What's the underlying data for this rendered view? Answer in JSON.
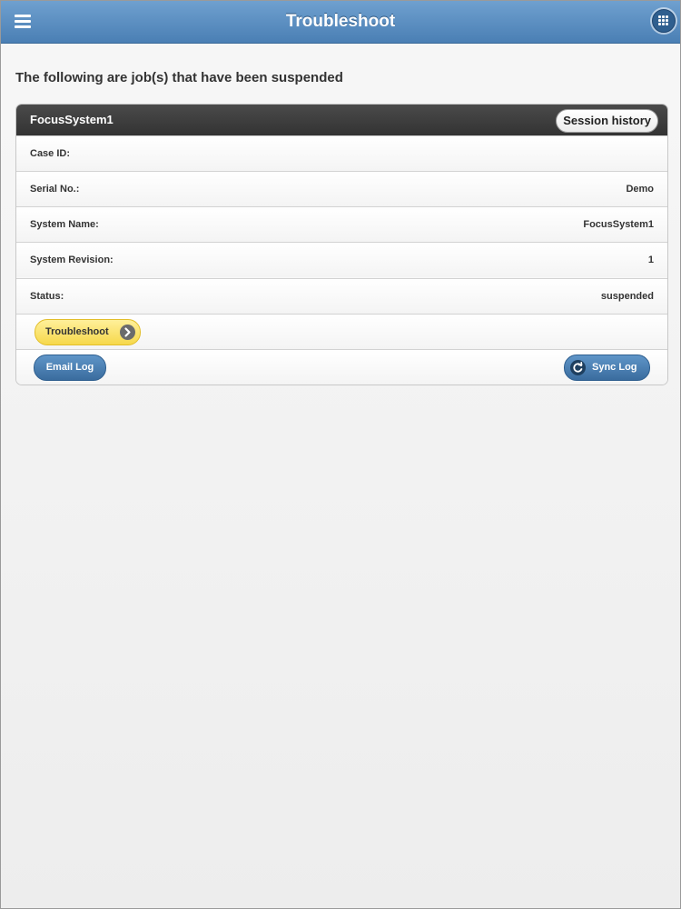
{
  "header": {
    "title": "Troubleshoot"
  },
  "main": {
    "heading": "The following are job(s) that have been suspended"
  },
  "card": {
    "title": "FocusSystem1",
    "session_history_label": "Session history",
    "rows": [
      {
        "label": "Case ID:",
        "value": ""
      },
      {
        "label": "Serial No.:",
        "value": "Demo"
      },
      {
        "label": "System Name:",
        "value": "FocusSystem1"
      },
      {
        "label": "System Revision:",
        "value": "1"
      },
      {
        "label": "Status:",
        "value": "suspended"
      }
    ],
    "troubleshoot_label": "Troubleshoot",
    "email_log_label": "Email Log",
    "sync_log_label": "Sync Log"
  },
  "icons": {
    "menu": "hamburger-menu-icon",
    "grid": "grid-icon",
    "troubleshoot_arrow": "chevron-right-icon",
    "sync": "refresh-icon"
  },
  "colors": {
    "header": "#4a7fb4",
    "card_header": "#333333",
    "troubleshoot_button": "#f6d84b",
    "action_button": "#3a6c9e"
  }
}
